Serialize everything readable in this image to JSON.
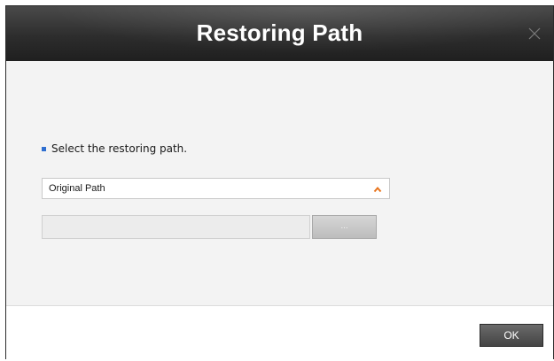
{
  "dialog": {
    "title": "Restoring Path",
    "close_icon": "close-icon"
  },
  "content": {
    "bullet_icon": "square-bullet-icon",
    "instruction": "Select the restoring path.",
    "path_select": {
      "selected": "Original Path",
      "caret_icon": "chevron-up-icon",
      "expanded": false
    },
    "path_input": {
      "value": "",
      "enabled": false
    },
    "browse_button": {
      "label": "...",
      "enabled": false
    }
  },
  "footer": {
    "ok_label": "OK"
  },
  "colors": {
    "titlebar": "#2d2d2d",
    "bullet": "#2f6fd0",
    "caret": "#e8741c",
    "body_bg": "#f3f3f3"
  }
}
